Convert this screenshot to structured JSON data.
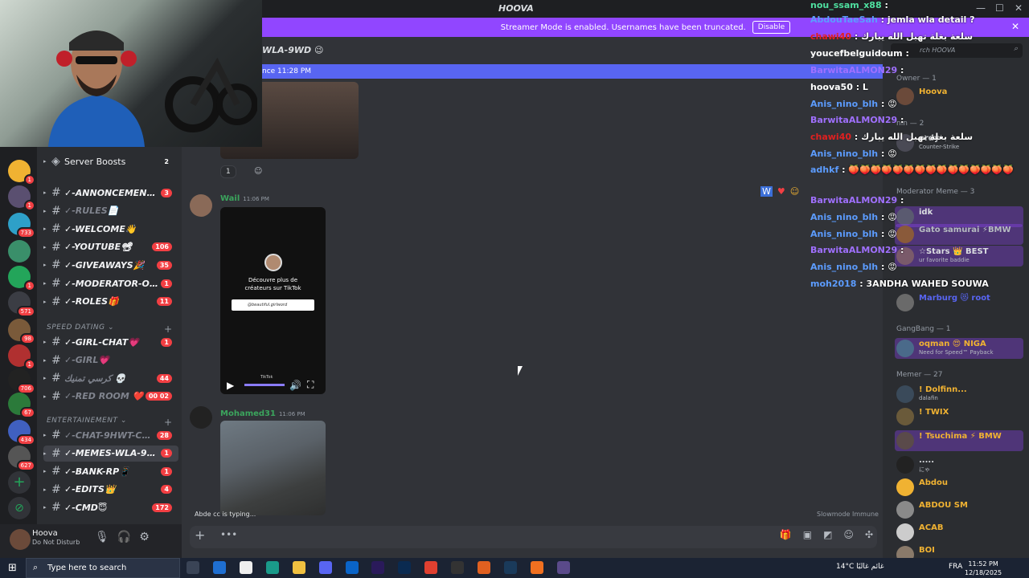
{
  "app": {
    "title": "HOOVA",
    "win_min": "—",
    "win_max": "☐",
    "win_close": "✕"
  },
  "banner": {
    "text": "Streamer Mode is enabled. Usernames have been truncated.",
    "button": "Disable"
  },
  "server_badges": [
    "1",
    "1",
    "733",
    "1",
    "571",
    "98",
    "1",
    "706",
    "67",
    "434",
    "627"
  ],
  "channels": {
    "server_boosts": {
      "label": "Server Boosts",
      "count": "2"
    },
    "items": [
      {
        "label": "✓-ANNONCEMENTS...",
        "count": "3"
      },
      {
        "label": "✓-RULES📄",
        "count": ""
      },
      {
        "label": "✓-WELCOME👋",
        "count": ""
      },
      {
        "label": "✓-YOUTUBE📽",
        "count": "106"
      },
      {
        "label": "✓-GIVEAWAYS🎉",
        "count": "35"
      },
      {
        "label": "✓-MODERATOR-ON...",
        "count": "1"
      },
      {
        "label": "✓-ROLES🎁",
        "count": "11"
      }
    ],
    "cat1": "SPEED DATING",
    "speed": [
      {
        "label": "✓-GIRL-CHAT💗",
        "count": "1"
      },
      {
        "label": "✓-GIRL💗",
        "count": ""
      },
      {
        "label": "كرسي تمنيك 💀",
        "count": "44"
      },
      {
        "label": "✓-RED ROOM ❤️",
        "count": "00 02"
      }
    ],
    "cat2": "ENTERTAINEMENT",
    "ent": [
      {
        "label": "✓-CHAT-9HWT-CH...",
        "count": "28"
      },
      {
        "label": "✓-MEMES-WLA-9W...",
        "count": "1"
      },
      {
        "label": "✓-BANK-RP📱",
        "count": "1"
      },
      {
        "label": "✓-EDITS👑",
        "count": "4"
      },
      {
        "label": "✓-CMD😇",
        "count": "172"
      }
    ]
  },
  "user": {
    "name": "Hoova",
    "status": "Do Not Disturb"
  },
  "chat": {
    "channel_title": "WLA-9WD 😉",
    "new_messages": "nce 11:28 PM",
    "reaction_count": "1",
    "msg1": {
      "user": "Wail",
      "time": "11:06 PM"
    },
    "tiktok": {
      "line1": "Découvre plus de",
      "line2": "créateurs sur TikTok",
      "search": "@beautiful.girlword",
      "brand": "TikTok"
    },
    "msg2": {
      "user": "Mohamed31",
      "time": "11:06 PM"
    },
    "typing": "Abde cc is typing...",
    "slowmode": "Slowmode Immune"
  },
  "members": {
    "search_placeholder": "rch HOOVA",
    "owner_group": "Owner — 1",
    "admin_group": "nin — 2",
    "mod_group": "Moderator Meme — 3",
    "gang_group": "GangBang — 1",
    "memer_group": "Memer — 27",
    "list": [
      {
        "name": "Hoova",
        "sub": "",
        "color": "#f0b232"
      },
      {
        "name": "ordy",
        "sub": "Counter-Strike",
        "color": "#dbdee1"
      },
      {
        "name": "idk",
        "sub": "",
        "color": "#dbdee1"
      },
      {
        "name": "Gato samurai ⚡BMW",
        "sub": "",
        "color": "#b5bac1"
      },
      {
        "name": "☆Stars 👑 BEST",
        "sub": "ur favorite baddie",
        "color": "#dbdee1"
      },
      {
        "name": "Marburg 😻 root",
        "sub": "",
        "color": "#5865f2"
      },
      {
        "name": "oqman 😍 NIGA",
        "sub": "Need for Speed™ Payback",
        "color": "#f0b232"
      },
      {
        "name": "! Dolfinn...",
        "sub": "dalafin",
        "color": "#f0b232"
      },
      {
        "name": "! TWIX",
        "sub": "",
        "color": "#f0b232"
      },
      {
        "name": "! Tsuchima ⚡ BMW",
        "sub": "",
        "color": "#f0b232"
      },
      {
        "name": ".....",
        "sub": "にゃ",
        "color": "#dbdee1"
      },
      {
        "name": "Abdou",
        "sub": "",
        "color": "#f0b232"
      },
      {
        "name": "ABDOU SM",
        "sub": "",
        "color": "#f0b232"
      },
      {
        "name": "ACAB",
        "sub": "",
        "color": "#f0b232"
      },
      {
        "name": "BOI",
        "sub": "",
        "color": "#f0b232"
      }
    ]
  },
  "stream_chat": [
    {
      "user": "nou_ssam_x88",
      "msg": "",
      "color": "#4fe0a0"
    },
    {
      "user": "AbdouTaeSah",
      "msg": "jemla wla detail ?",
      "color": "#5c9cff"
    },
    {
      "user": "chawi40",
      "msg": "سلعة بغلة تهبل الله يبارك",
      "color": "#e02020"
    },
    {
      "user": "youcefbelguidoum",
      "msg": "",
      "color": "#ffffff"
    },
    {
      "user": "BarwitaALMON29",
      "msg": "",
      "color": "#a070ff"
    },
    {
      "user": "hoova50",
      "msg": "L",
      "color": "#ffffff"
    },
    {
      "user": "Anis_nino_blh",
      "msg": "😡",
      "color": "#5c9cff"
    },
    {
      "user": "BarwitaALMON29",
      "msg": "",
      "color": "#a070ff"
    },
    {
      "user": "chawi40",
      "msg": "سلعة بغلة تهبل الله يبارك",
      "color": "#e02020"
    },
    {
      "user": "Anis_nino_blh",
      "msg": "😡",
      "color": "#5c9cff"
    },
    {
      "user": "adhkf",
      "msg": "🍑🍑🍑🍑🍑🍑🍑🍑🍑🍑🍑🍑🍑🍑🍑",
      "color": "#5c9cff"
    },
    {
      "user": "BarwitaALMON29",
      "msg": "",
      "color": "#a070ff"
    },
    {
      "user": "Anis_nino_blh",
      "msg": "😡",
      "color": "#5c9cff"
    },
    {
      "user": "Anis_nino_blh",
      "msg": "😡",
      "color": "#5c9cff"
    },
    {
      "user": "BarwitaALMON29",
      "msg": "",
      "color": "#a070ff"
    },
    {
      "user": "Anis_nino_blh",
      "msg": "😡",
      "color": "#5c9cff"
    },
    {
      "user": "moh2018",
      "msg": "3ANDHA WAHED SOUWA",
      "color": "#5c9cff"
    }
  ],
  "taskbar": {
    "search": "Type here to search",
    "weather": "14°C غائم غالبًا",
    "lang": "FRA",
    "time": "11:52 PM",
    "date": "12/18/2025"
  }
}
